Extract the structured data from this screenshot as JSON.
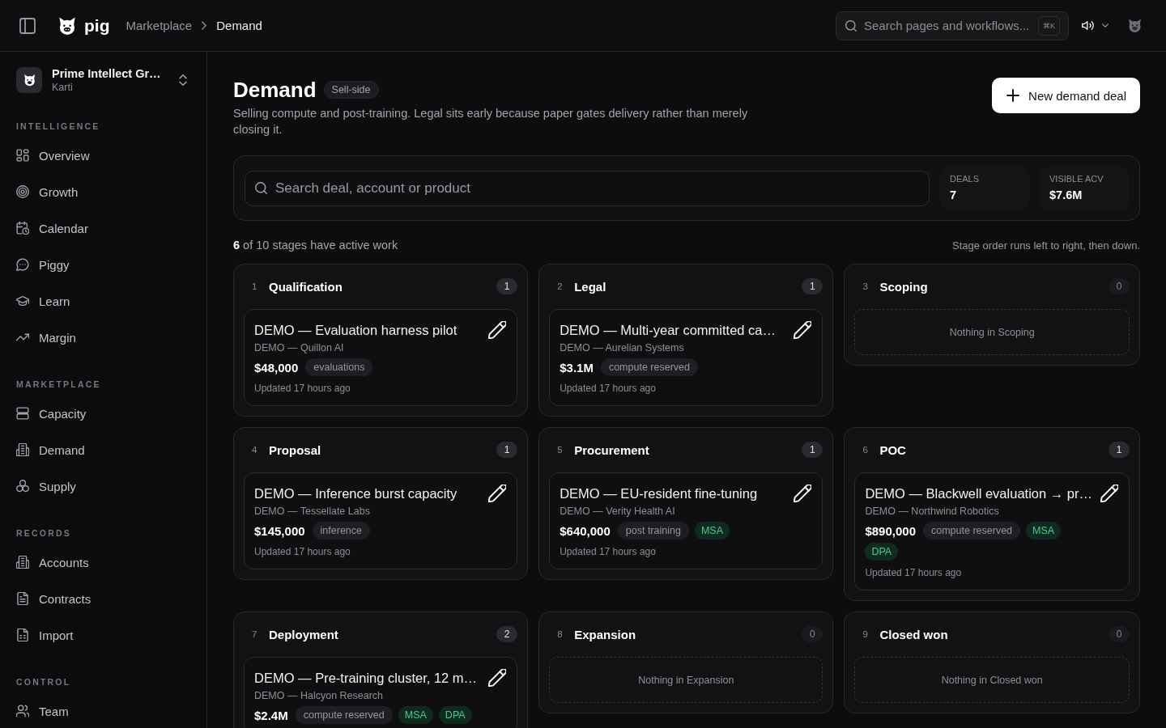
{
  "topbar": {
    "brand": "pig",
    "breadcrumb": [
      {
        "label": "Marketplace",
        "current": false
      },
      {
        "label": "Demand",
        "current": true
      }
    ],
    "search": {
      "placeholder": "Search pages and workflows...",
      "shortcut": "⌘K"
    }
  },
  "sidebar": {
    "org": {
      "name": "Prime Intellect Gr…",
      "user": "Karti"
    },
    "sections": [
      {
        "title": "INTELLIGENCE",
        "items": [
          {
            "label": "Overview",
            "selected": false
          },
          {
            "label": "Growth",
            "selected": false
          },
          {
            "label": "Calendar",
            "selected": false
          },
          {
            "label": "Piggy",
            "selected": false
          },
          {
            "label": "Learn",
            "selected": false
          },
          {
            "label": "Margin",
            "selected": false
          }
        ]
      },
      {
        "title": "MARKETPLACE",
        "items": [
          {
            "label": "Capacity",
            "selected": false
          },
          {
            "label": "Demand",
            "selected": false
          },
          {
            "label": "Supply",
            "selected": false
          }
        ]
      },
      {
        "title": "RECORDS",
        "items": [
          {
            "label": "Accounts",
            "selected": false
          },
          {
            "label": "Contracts",
            "selected": false
          },
          {
            "label": "Import",
            "selected": false
          }
        ]
      },
      {
        "title": "CONTROL",
        "items": [
          {
            "label": "Team",
            "selected": false
          }
        ]
      }
    ]
  },
  "header": {
    "title": "Demand",
    "badge": "Sell-side",
    "description": "Selling compute and post-training. Legal sits early because paper gates delivery rather than merely closing it.",
    "button": "New demand deal"
  },
  "filters": {
    "search": {
      "placeholder": "Search deal, account or product"
    },
    "stats": [
      {
        "label": "DEALS",
        "value": "7"
      },
      {
        "label": "VISIBLE ACV",
        "value": "$7.6M"
      }
    ]
  },
  "summary": {
    "text": "**6** of 10 stages have active work",
    "note": "Stage order runs left to right, then down."
  },
  "stages": [
    {
      "number": "1",
      "name": "Qualification",
      "count": "1",
      "deals": [
        {
          "title": "DEMO — Evaluation harness pilot",
          "account": "DEMO — Quillon AI",
          "amount": "$48,000",
          "tags": [
            {
              "label": "evaluations",
              "kind": "product"
            }
          ],
          "updated": "Updated 17 hours ago"
        }
      ]
    },
    {
      "number": "2",
      "name": "Legal",
      "count": "1",
      "deals": [
        {
          "title": "DEMO — Multi-year committed ca…",
          "account": "DEMO — Aurelian Systems",
          "amount": "$3.1M",
          "tags": [
            {
              "label": "compute reserved",
              "kind": "product"
            }
          ],
          "updated": "Updated 17 hours ago"
        }
      ]
    },
    {
      "number": "3",
      "name": "Scoping",
      "count": "0",
      "empty": "Nothing in Scoping"
    },
    {
      "number": "4",
      "name": "Proposal",
      "count": "1",
      "deals": [
        {
          "title": "DEMO — Inference burst capacity",
          "account": "DEMO — Tessellate Labs",
          "amount": "$145,000",
          "tags": [
            {
              "label": "inference",
              "kind": "product"
            }
          ],
          "updated": "Updated 17 hours ago"
        }
      ]
    },
    {
      "number": "5",
      "name": "Procurement",
      "count": "1",
      "deals": [
        {
          "title": "DEMO — EU-resident fine-tuning",
          "account": "DEMO — Verity Health AI",
          "amount": "$640,000",
          "tags": [
            {
              "label": "post training",
              "kind": "product"
            },
            {
              "label": "MSA",
              "kind": "document"
            }
          ],
          "updated": "Updated 17 hours ago"
        }
      ]
    },
    {
      "number": "6",
      "name": "POC",
      "count": "1",
      "deals": [
        {
          "title": "DEMO — Blackwell evaluation → pr…",
          "account": "DEMO — Northwind Robotics",
          "amount": "$890,000",
          "tags": [
            {
              "label": "compute reserved",
              "kind": "product"
            },
            {
              "label": "MSA",
              "kind": "document"
            },
            {
              "label": "DPA",
              "kind": "document"
            }
          ],
          "updated": "Updated 17 hours ago"
        }
      ]
    },
    {
      "number": "7",
      "name": "Deployment",
      "count": "2",
      "deals": [
        {
          "title": "DEMO — Pre-training cluster, 12 m…",
          "account": "DEMO — Halcyon Research",
          "amount": "$2.4M",
          "tags": [
            {
              "label": "compute reserved",
              "kind": "product"
            },
            {
              "label": "MSA",
              "kind": "document"
            },
            {
              "label": "DPA",
              "kind": "document"
            }
          ]
        }
      ]
    },
    {
      "number": "8",
      "name": "Expansion",
      "count": "0",
      "empty": "Nothing in Expansion"
    },
    {
      "number": "9",
      "name": "Closed won",
      "count": "0",
      "empty": "Nothing in Closed won"
    }
  ]
}
